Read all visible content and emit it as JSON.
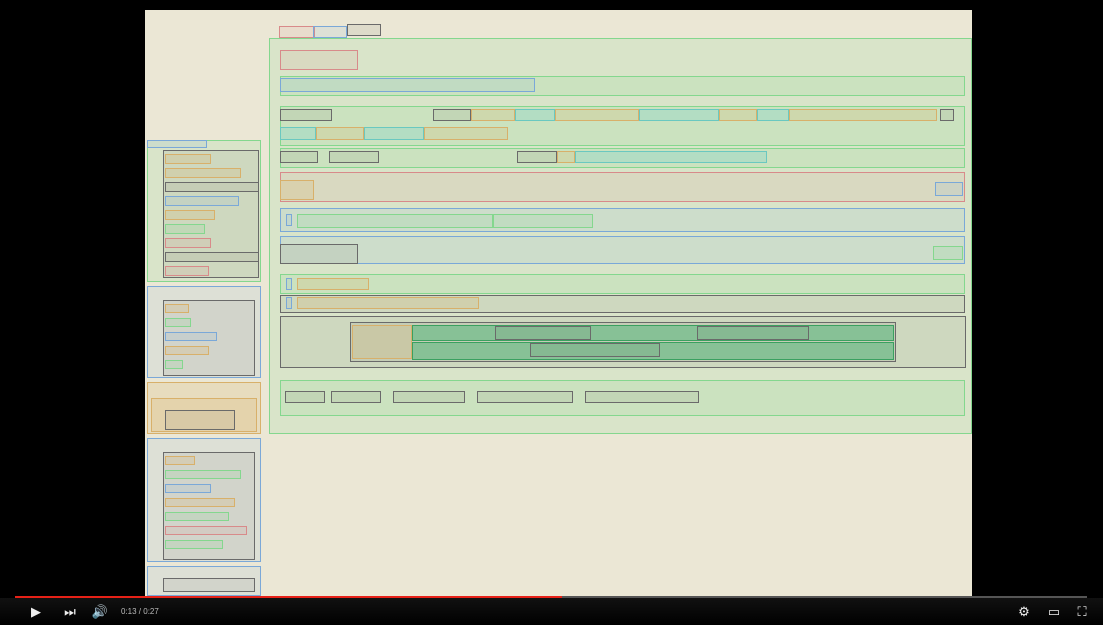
{
  "player": {
    "current_time": "0:13",
    "separator": " / ",
    "duration": "0:27",
    "progress": 0.51,
    "colors": {
      "progress_fill": "#e62117",
      "track": "#555555",
      "frame_bg": "#ebe7d5"
    },
    "icons": {
      "play": "play-icon",
      "next": "next-icon",
      "volume": "volume-icon",
      "settings": "gear-icon",
      "theater": "theater-mode-icon",
      "fullscreen": "fullscreen-icon"
    },
    "glyphs": {
      "play": "▶",
      "next": "⏭",
      "volume": "🔊",
      "settings": "⚙",
      "theater": "▭",
      "fullscreen": "⛶"
    }
  }
}
